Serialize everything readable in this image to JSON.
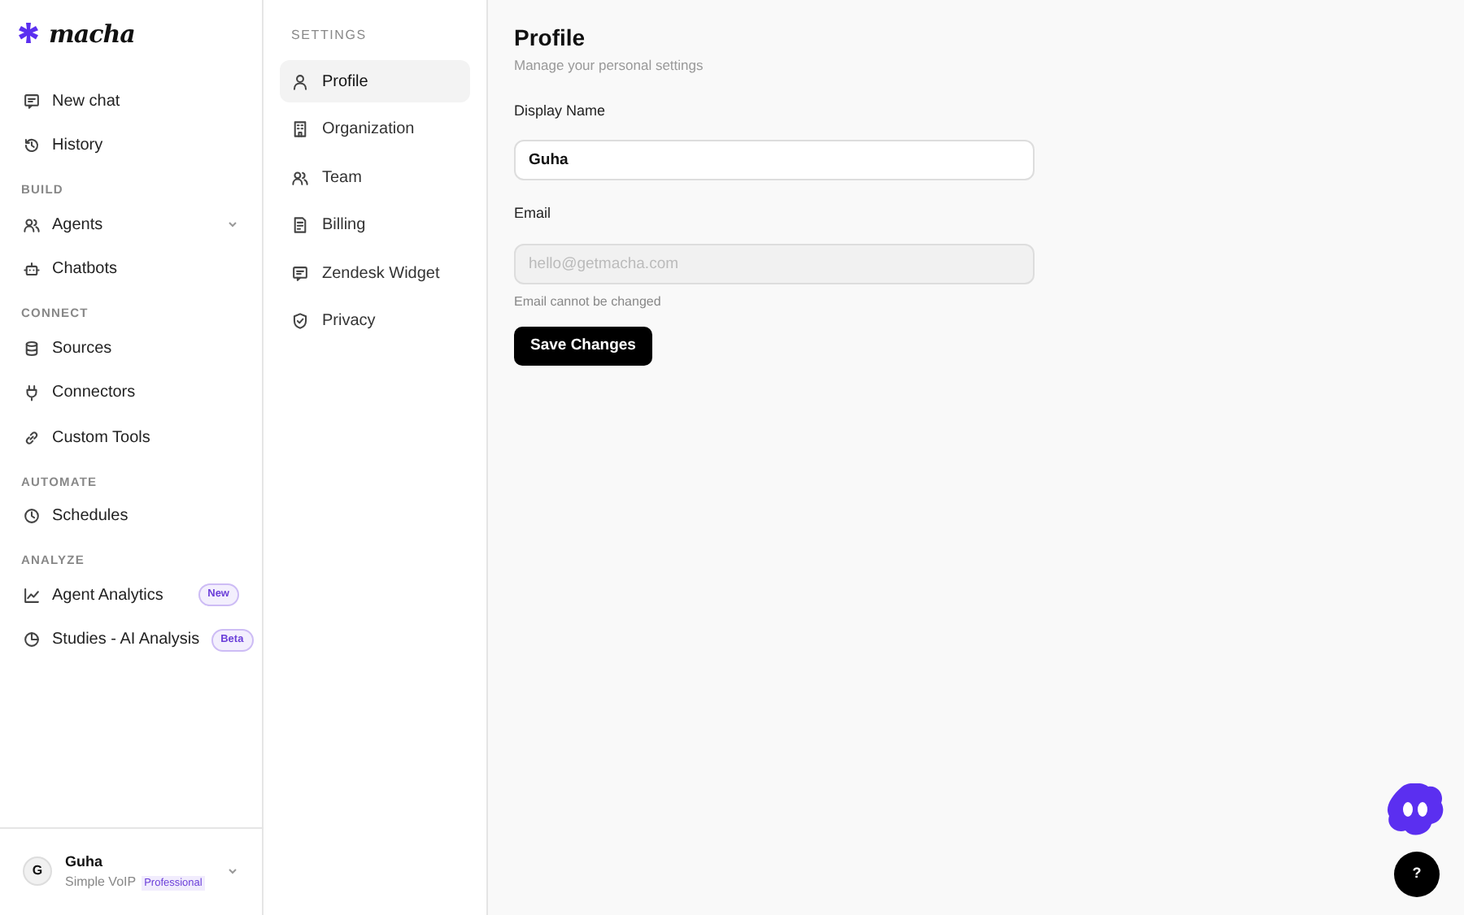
{
  "brand": {
    "name": "macha"
  },
  "sidebar": {
    "sections": [
      {
        "items": [
          {
            "label": "New chat"
          },
          {
            "label": "History"
          }
        ]
      },
      {
        "heading": "BUILD",
        "items": [
          {
            "label": "Agents",
            "expanded": false
          },
          {
            "label": "Chatbots"
          }
        ]
      },
      {
        "heading": "CONNECT",
        "items": [
          {
            "label": "Sources"
          },
          {
            "label": "Connectors"
          },
          {
            "label": "Custom Tools"
          }
        ]
      },
      {
        "heading": "AUTOMATE",
        "items": [
          {
            "label": "Schedules"
          }
        ]
      },
      {
        "heading": "ANALYZE",
        "items": [
          {
            "label": "Agent Analytics",
            "badge": "New"
          },
          {
            "label": "Studies - AI Analysis",
            "badge": "Beta"
          }
        ]
      }
    ],
    "user": {
      "initial": "G",
      "name": "Guha",
      "org": "Simple VoIP",
      "plan": "Professional"
    }
  },
  "settings_nav": {
    "heading": "SETTINGS",
    "items": [
      {
        "label": "Profile",
        "selected": true
      },
      {
        "label": "Organization",
        "selected": false
      },
      {
        "label": "Team",
        "selected": false
      },
      {
        "label": "Billing",
        "selected": false
      },
      {
        "label": "Zendesk Widget",
        "selected": false
      },
      {
        "label": "Privacy",
        "selected": false
      }
    ]
  },
  "profile": {
    "title": "Profile",
    "subtitle": "Manage your personal settings",
    "fields": [
      {
        "label": "Display Name",
        "value": "Guha",
        "disabled": false
      },
      {
        "label": "Email",
        "value": "hello@getmacha.com",
        "disabled": true,
        "hint": "Email cannot be changed"
      }
    ],
    "save_button": "Save Changes"
  },
  "help_button": "?"
}
